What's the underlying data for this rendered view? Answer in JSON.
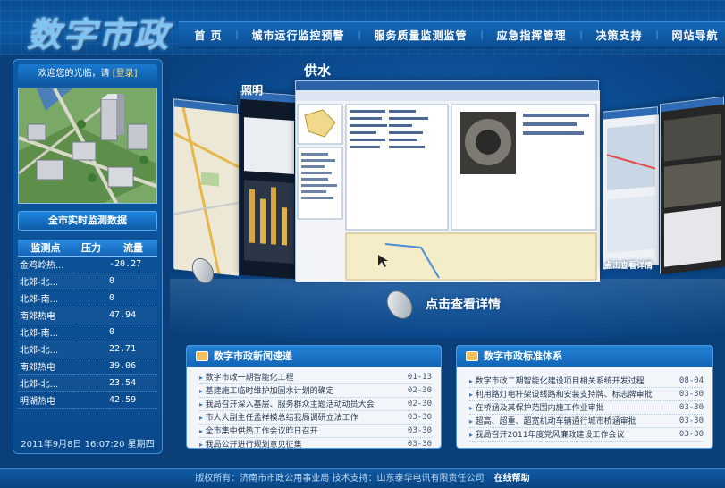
{
  "logo": {
    "text": "数字市政"
  },
  "nav": {
    "items": [
      {
        "label": "首 页"
      },
      {
        "label": "城市运行监控预警"
      },
      {
        "label": "服务质量监测监管"
      },
      {
        "label": "应急指挥管理"
      },
      {
        "label": "决策支持"
      },
      {
        "label": "网站导航"
      }
    ]
  },
  "sidebar": {
    "welcome_text": "欢迎您的光临，请",
    "login_label": "[登录]",
    "monitor_title": "全市实时监测数据",
    "table": {
      "headers": [
        "监测点",
        "压力",
        "流量"
      ],
      "rows": [
        [
          "金鸡岭热...",
          "",
          "-20.27"
        ],
        [
          "北郊-北...",
          "",
          "0"
        ],
        [
          "北郊-南...",
          "",
          "0"
        ],
        [
          "南郊热电",
          "",
          "47.94"
        ],
        [
          "北郊-南...",
          "",
          "0"
        ],
        [
          "北郊-北...",
          "",
          "22.71"
        ],
        [
          "南郊热电",
          "",
          "39.06"
        ],
        [
          "北郊-北...",
          "",
          "23.54"
        ],
        [
          "明湖热电",
          "",
          "42.59"
        ]
      ]
    },
    "datetime": "2011年9月8日  16:07:20  星期四"
  },
  "showcase": {
    "main_label": "供水",
    "left_label": "照明",
    "detail_link": "点击查看详情",
    "side_detail_link": "点击查看详情"
  },
  "news_left": {
    "title": "数字市政新闻速递",
    "items": [
      {
        "title": "数字市政一期智能化工程",
        "date": "01-13"
      },
      {
        "title": "基建施工临时维护加固水计划的确定",
        "date": "02-30"
      },
      {
        "title": "我局召开深入基层、服务群众主题活动动员大会",
        "date": "02-30"
      },
      {
        "title": "市人大副主任孟祥模总结我局调研立法工作",
        "date": "03-30"
      },
      {
        "title": "全市集中供热工作会议昨日召开",
        "date": "03-30"
      },
      {
        "title": "我局公开进行规划意见征集",
        "date": "03-30"
      }
    ]
  },
  "news_right": {
    "title": "数字市政标准体系",
    "items": [
      {
        "title": "数字市政二期智能化建设项目相关系统开发过程",
        "date": "08-04"
      },
      {
        "title": "利用路灯电杆架设线路和安装支持牌、标志牌审批",
        "date": "03-30"
      },
      {
        "title": "在桥涵及其保护范围内施工作业审批",
        "date": "03-30"
      },
      {
        "title": "超高、超重、超宽机动车辆通行城市桥涵审批",
        "date": "03-30"
      },
      {
        "title": "我局召开2011年度党风廉政建设工作会议",
        "date": "03-30"
      }
    ]
  },
  "footer": {
    "copyright": "版权所有：济南市市政公用事业局  技术支持：山东泰华电讯有限责任公司",
    "help_label": "在线帮助"
  }
}
